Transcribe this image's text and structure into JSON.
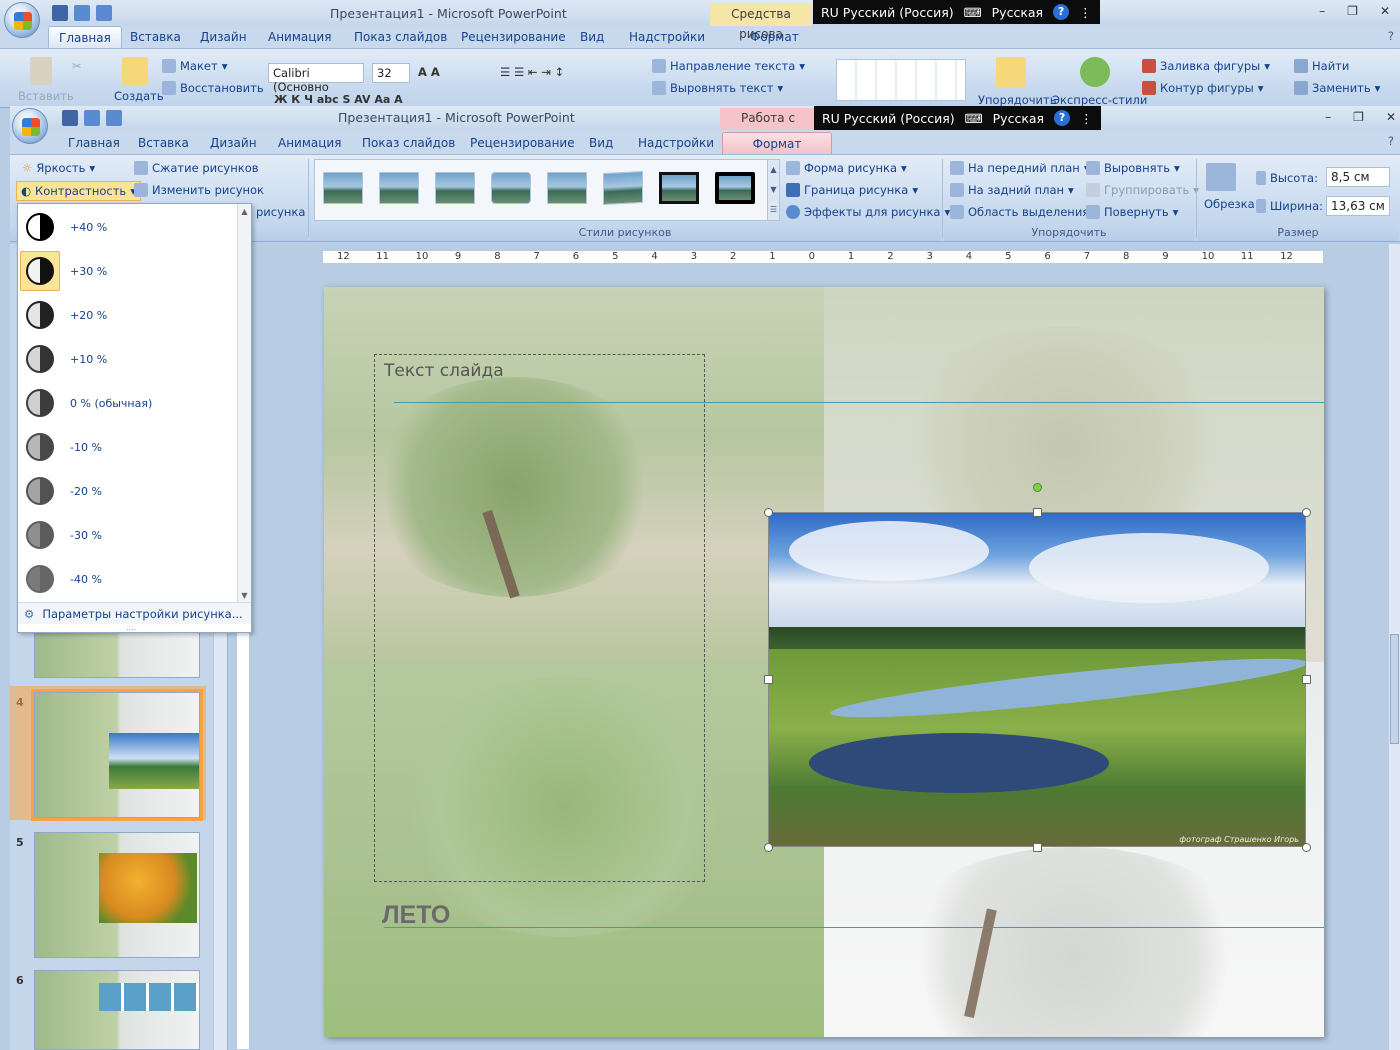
{
  "back_window": {
    "title": "Презентация1 - Microsoft PowerPoint",
    "context_tab": "Средства рисова",
    "language_bar": {
      "lang": "RU Русский (Россия)",
      "keyboard": "Русская",
      "help": "?"
    },
    "tabs": [
      "Главная",
      "Вставка",
      "Дизайн",
      "Анимация",
      "Показ слайдов",
      "Рецензирование",
      "Вид",
      "Надстройки",
      "Формат"
    ],
    "active_tab": "Главная",
    "ribbon": {
      "paste": "Вставить",
      "create": "Создать",
      "layout": "Макет",
      "restore": "Восстановить",
      "font_name": "Calibri (Основно",
      "font_size": "32",
      "text_direction": "Направление текста",
      "align_text": "Выровнять текст",
      "arrange": "Упорядочить",
      "quick_styles": "Экспресс-стили",
      "shape_fill": "Заливка фигуры",
      "shape_outline": "Контур фигуры",
      "find": "Найти",
      "replace": "Заменить"
    }
  },
  "front_window": {
    "title": "Презентация1 - Microsoft PowerPoint",
    "context_tab": "Работа с рисунк",
    "language_bar": {
      "lang": "RU Русский (Россия)",
      "keyboard": "Русская",
      "help": "?"
    },
    "tabs": [
      "Главная",
      "Вставка",
      "Дизайн",
      "Анимация",
      "Показ слайдов",
      "Рецензирование",
      "Вид",
      "Надстройки",
      "Формат"
    ],
    "active_tab": "Формат",
    "ribbon": {
      "brightness": "Яркость",
      "contrast": "Контрастность",
      "compress": "Сжатие рисунков",
      "change_picture": "Изменить рисунок",
      "reset_picture_tail": "рисунка",
      "picture_styles_label": "Стили рисунков",
      "picture_shape": "Форма рисунка",
      "picture_border": "Граница рисунка",
      "picture_effects": "Эффекты для рисунка",
      "bring_front": "На передний план",
      "send_back": "На задний план",
      "selection_pane": "Область выделения",
      "align": "Выровнять",
      "group": "Группировать",
      "rotate": "Повернуть",
      "arrange_label": "Упорядочить",
      "crop": "Обрезка",
      "height_label": "Высота:",
      "height_value": "8,5 см",
      "width_label": "Ширина:",
      "width_value": "13,63 см",
      "size_label": "Размер"
    }
  },
  "contrast_menu": {
    "items": [
      "+40 %",
      "+30 %",
      "+20 %",
      "+10 %",
      "0 % (обычная)",
      "-10 %",
      "-20 %",
      "-30 %",
      "-40 %"
    ],
    "highlighted": "+30 %",
    "footer": "Параметры настройки рисунка..."
  },
  "slides_panel": {
    "numbers": [
      "4",
      "5",
      "6"
    ]
  },
  "ruler": {
    "labels": [
      "12",
      "11",
      "10",
      "9",
      "8",
      "7",
      "6",
      "5",
      "4",
      "3",
      "2",
      "1",
      "0",
      "1",
      "2",
      "3",
      "4",
      "5",
      "6",
      "7",
      "8",
      "9",
      "10",
      "11",
      "12"
    ]
  },
  "slide": {
    "placeholder_text": "Текст слайда",
    "season_label": "ЛЕТО",
    "photo_credit": "фотограф Страшенко Игорь"
  },
  "colors": {
    "ribbon_text": "#15428b",
    "active_contextual_tab": "#f4c4c9",
    "selection_highlight": "#fde395",
    "slide_line": "#3c9fb0"
  }
}
